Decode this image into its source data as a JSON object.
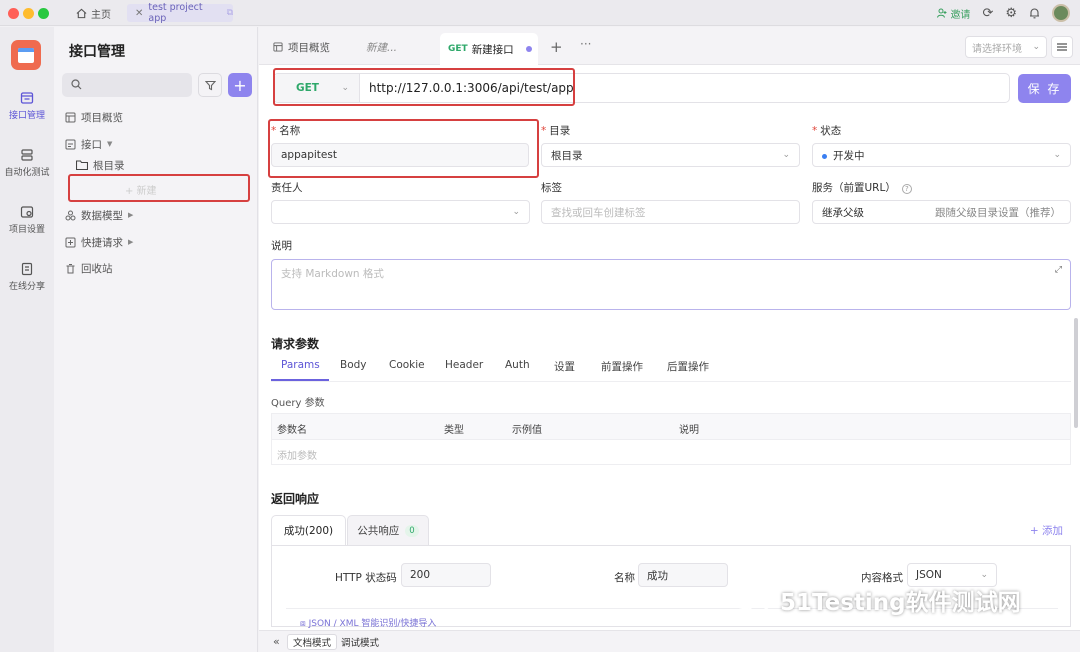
{
  "titlebar": {
    "home_label": "主页",
    "project_tab": "test project app",
    "invite_label": "邀请",
    "colors": {
      "close": "#ff5f57",
      "minimize": "#febc2e",
      "zoom": "#28c840"
    }
  },
  "rail": {
    "items": [
      {
        "label": "接口管理",
        "icon": "api-icon"
      },
      {
        "label": "自动化测试",
        "icon": "automation-icon"
      },
      {
        "label": "项目设置",
        "icon": "settings-icon"
      },
      {
        "label": "在线分享",
        "icon": "share-icon"
      }
    ]
  },
  "sidebar": {
    "title": "接口管理",
    "items": {
      "overview": "项目概览",
      "apis": "接口",
      "root": "根目录",
      "new": "+ 新建",
      "models": "数据模型",
      "quick": "快捷请求",
      "recycle": "回收站"
    }
  },
  "tabs": {
    "overview": "项目概览",
    "draft": "新建...",
    "active_method": "GET",
    "active_label": "新建接口",
    "env_placeholder": "请选择环境"
  },
  "request": {
    "method": "GET",
    "url": "http://127.0.0.1:3006/api/test/app",
    "save_label": "保 存"
  },
  "form": {
    "name_label": "名称",
    "name_value": "appapitest",
    "dir_label": "目录",
    "dir_value": "根目录",
    "status_label": "状态",
    "status_value": "开发中",
    "owner_label": "责任人",
    "tags_label": "标签",
    "tags_placeholder": "查找或回车创建标签",
    "service_label": "服务（前置URL）",
    "service_value": "继承父级",
    "service_hint": "跟随父级目录设置（推荐）",
    "desc_label": "说明",
    "desc_placeholder": "支持 Markdown 格式"
  },
  "params": {
    "section_title": "请求参数",
    "tabs": [
      "Params",
      "Body",
      "Cookie",
      "Header",
      "Auth",
      "设置",
      "前置操作",
      "后置操作"
    ],
    "query_label": "Query 参数",
    "columns": [
      "参数名",
      "类型",
      "示例值",
      "说明"
    ],
    "add_placeholder": "添加参数"
  },
  "response": {
    "section_title": "返回响应",
    "tab_success": "成功(200)",
    "tab_common": "公共响应",
    "tab_common_count": "0",
    "add_label": "+ 添加",
    "http_code_label": "HTTP 状态码",
    "http_code_value": "200",
    "name_label": "名称",
    "name_value": "成功",
    "format_label": "内容格式",
    "format_value": "JSON",
    "import_hint": "JSON / XML 智能识别/快捷导入"
  },
  "bottom": {
    "doc_mode": "文档模式",
    "debug_mode": "调试模式"
  },
  "watermark": "51Testing软件测试网"
}
